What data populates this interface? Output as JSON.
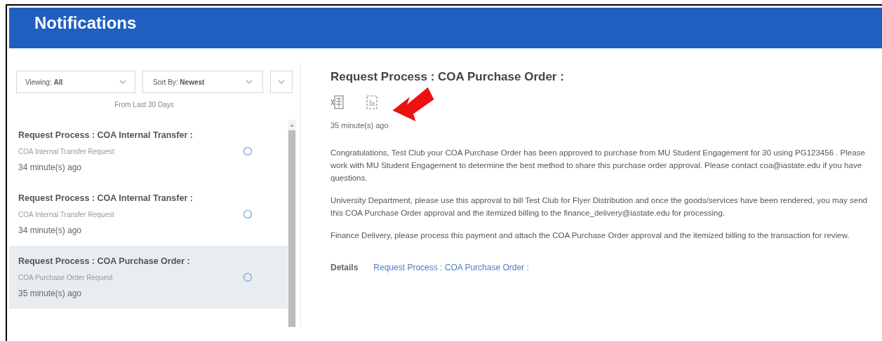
{
  "header": {
    "title": "Notifications"
  },
  "filters": {
    "viewing": "Viewing: **All**",
    "sort": "Sort By: **Newest**",
    "range": "From Last 30 Days"
  },
  "notifications": [
    {
      "title": "Request Process : COA Internal Transfer :",
      "subtitle": "COA Internal Transfer Request",
      "time": "34 minute(s) ago",
      "selected": false
    },
    {
      "title": "Request Process : COA Internal Transfer :",
      "subtitle": "COA Internal Transfer Request",
      "time": "34 minute(s) ago",
      "selected": false
    },
    {
      "title": "Request Process : COA Purchase Order :",
      "subtitle": "COA Purchase Order Request",
      "time": "35 minute(s) ago",
      "selected": true
    }
  ],
  "detail": {
    "title": "Request Process : COA Purchase Order :",
    "time": "35 minute(s) ago",
    "paragraphs": [
      "Congratulations, Test Club your COA Purchase Order has been approved to purchase from MU Student Engagement for 30 using PG123456 . Please work with MU Student Engagement to determine the best method to share this purchase order approval. Please contact coa@iastate.edu if you have questions.",
      "University Department, please use this approval to bill Test Club for Flyer Distribution and once the goods/services have been rendered, you may send this COA Purchase Order approval and the itemized billing to the finance_delivery@iastate.edu for processing.",
      "Finance Delivery, please process this payment and attach the COA Purchase Order approval and the itemized billing to the transaction for review."
    ],
    "details_label": "Details",
    "details_link": "Request Process : COA Purchase Order :"
  }
}
